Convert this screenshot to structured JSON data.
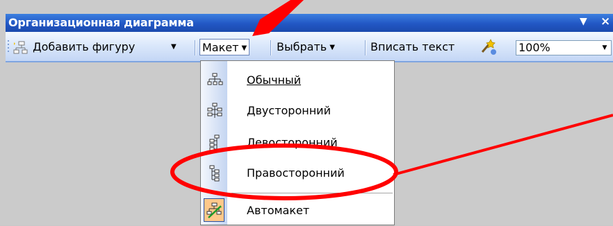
{
  "window": {
    "title": "Организационная диаграмма",
    "controls": {
      "menu": "▼",
      "close": "×"
    }
  },
  "toolbar": {
    "add_shape_label": "Добавить фигуру",
    "layout_label": "Макет",
    "select_label": "Выбрать",
    "fit_text_label": "Вписать текст",
    "zoom_value": "100%"
  },
  "layout_menu": {
    "items": [
      {
        "label": "Обычный",
        "icon": "org-standard-icon"
      },
      {
        "label": "Двусторонний",
        "icon": "org-both-hanging-icon"
      },
      {
        "label": "Левосторонний",
        "icon": "org-left-hanging-icon"
      },
      {
        "label": "Правосторонний",
        "icon": "org-right-hanging-icon"
      },
      {
        "label": "Автомакет",
        "icon": "autolayout-icon",
        "checked": true
      }
    ]
  },
  "colors": {
    "annotation": "#ff0000",
    "title_bar": "#2257c4",
    "toolbar": "#dbe8fb"
  }
}
